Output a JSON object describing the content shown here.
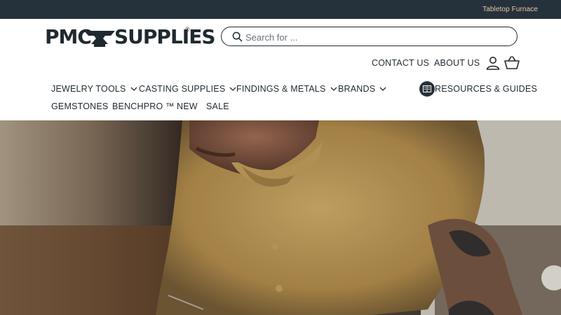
{
  "topbar": {
    "link": "Tabletop Furnace"
  },
  "logo": {
    "left": "PMC",
    "right": "SUPPLIES",
    "reg": "®"
  },
  "search": {
    "placeholder": "Search for ..."
  },
  "utility": {
    "contact": "CONTACT US",
    "about": "ABOUT US"
  },
  "nav": {
    "row1": [
      "JEWELRY TOOLS",
      "CASTING SUPPLIES",
      "FINDINGS & METALS",
      "BRANDS"
    ],
    "resources": "RESOURCES & GUIDES",
    "row2": [
      "GEMSTONES",
      "BENCHPRO ™",
      "NEW",
      "SALE"
    ]
  },
  "icons": {
    "search": "search-icon",
    "account": "account-icon",
    "cart": "cart-icon",
    "chevron": "chevron-down-icon",
    "book": "book-icon",
    "anvil": "anvil-icon"
  },
  "colors": {
    "topbar_bg": "#25323b",
    "topbar_link": "#e7c8a3",
    "text": "#1f2a30"
  }
}
